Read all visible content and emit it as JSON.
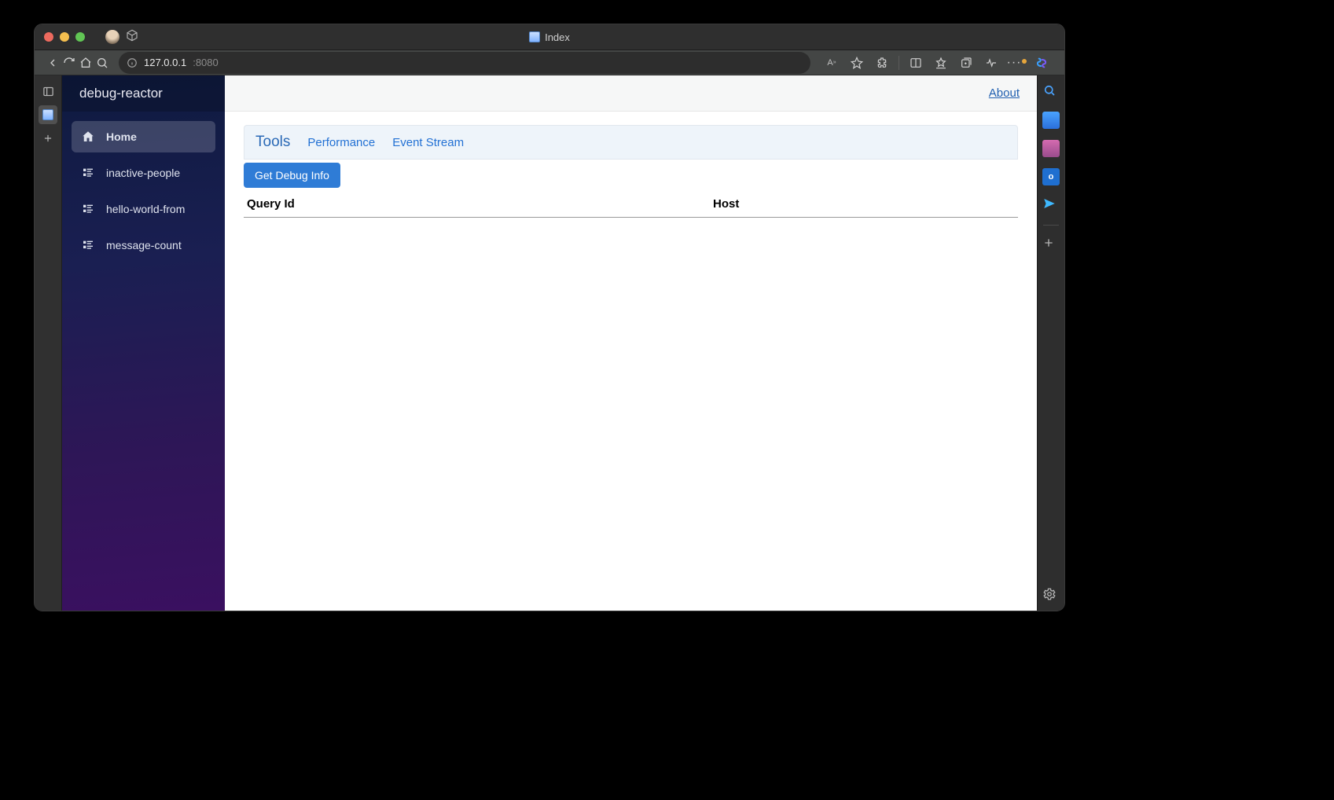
{
  "window": {
    "title": "Index",
    "traffic_colors": {
      "close": "#ed6a5e",
      "min": "#f5bf4f",
      "max": "#61c554"
    }
  },
  "address": {
    "host": "127.0.0.1",
    "port": ":8080"
  },
  "app": {
    "title": "debug-reactor",
    "header_link": "About"
  },
  "sidebar": {
    "items": [
      {
        "label": "Home",
        "icon": "home-icon",
        "active": true
      },
      {
        "label": "inactive-people",
        "icon": "list-icon",
        "active": false
      },
      {
        "label": "hello-world-from",
        "icon": "list-icon",
        "active": false
      },
      {
        "label": "message-count",
        "icon": "list-icon",
        "active": false
      }
    ]
  },
  "tabs": {
    "active": "Tools",
    "links": [
      {
        "label": "Performance"
      },
      {
        "label": "Event Stream"
      }
    ]
  },
  "actions": {
    "get_debug_info": "Get Debug Info"
  },
  "table": {
    "columns": [
      {
        "label": "Query Id"
      },
      {
        "label": "Host"
      }
    ],
    "rows": []
  }
}
